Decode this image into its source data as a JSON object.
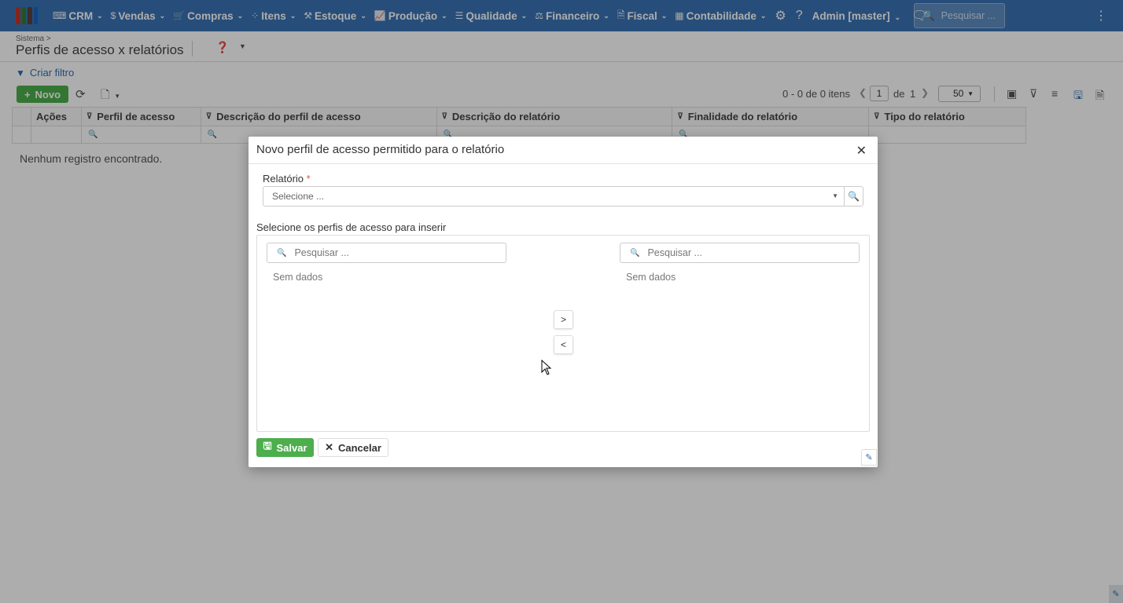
{
  "nav": {
    "logo_colors": [
      "#c0392b",
      "#2e7d32",
      "#5d4037",
      "#1565c0"
    ],
    "items": [
      {
        "label": "CRM",
        "icon": "crm-icon",
        "glyph": "⌨"
      },
      {
        "label": "Vendas",
        "icon": "dollar-icon",
        "glyph": "$"
      },
      {
        "label": "Compras",
        "icon": "cart-icon",
        "glyph": "🛒"
      },
      {
        "label": "Itens",
        "icon": "items-icon",
        "glyph": "⁘"
      },
      {
        "label": "Estoque",
        "icon": "warehouse-icon",
        "glyph": "⚒"
      },
      {
        "label": "Produção",
        "icon": "production-icon",
        "glyph": "📈"
      },
      {
        "label": "Qualidade",
        "icon": "quality-icon",
        "glyph": "☰"
      },
      {
        "label": "Financeiro",
        "icon": "bank-icon",
        "glyph": "⚖"
      },
      {
        "label": "Fiscal",
        "icon": "fiscal-icon",
        "glyph": "🗎"
      },
      {
        "label": "Contabilidade",
        "icon": "calculator-icon",
        "glyph": "▦"
      }
    ],
    "user": "Admin [master]",
    "search_placeholder": "Pesquisar ..."
  },
  "header": {
    "breadcrumb": "Sistema >",
    "title": "Perfis de acesso x relatórios"
  },
  "toolbar": {
    "criar_filtro": "Criar filtro",
    "novo": "Novo",
    "pager_info": "0 - 0 de 0 itens",
    "page": "1",
    "de": "de",
    "total_pages": "1",
    "page_size": "50"
  },
  "grid": {
    "columns": [
      "Ações",
      "Perfil de acesso",
      "Descrição do perfil de acesso",
      "Descrição do relatório",
      "Finalidade do relatório",
      "Tipo do relatório"
    ],
    "empty": "Nenhum registro encontrado."
  },
  "modal": {
    "title": "Novo perfil de acesso permitido para o relatório",
    "relatorio_label": "Relatório",
    "required_mark": "*",
    "relatorio_placeholder": "Selecione ...",
    "selecione_label": "Selecione os perfis de acesso para inserir",
    "left_search_placeholder": "Pesquisar ...",
    "right_search_placeholder": "Pesquisar ...",
    "left_empty": "Sem dados",
    "right_empty": "Sem dados",
    "move_right": ">",
    "move_left": "<",
    "salvar": "Salvar",
    "cancelar": "Cancelar"
  },
  "colors": {
    "nav_bg": "#3a73b4",
    "primary_green": "#4cae4c",
    "link_blue": "#2f6fb0"
  }
}
